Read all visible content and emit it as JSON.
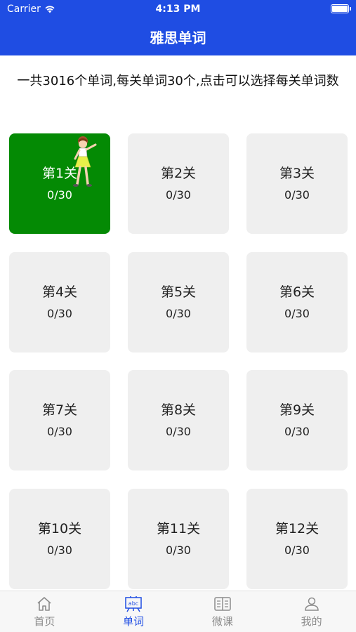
{
  "status": {
    "carrier": "Carrier",
    "time": "4:13 PM"
  },
  "header": {
    "title": "雅思单词"
  },
  "description": "一共3016个单词,每关单词30个,点击可以选择每关单词数",
  "levels": [
    {
      "label": "第1关",
      "progress": "0/30"
    },
    {
      "label": "第2关",
      "progress": "0/30"
    },
    {
      "label": "第3关",
      "progress": "0/30"
    },
    {
      "label": "第4关",
      "progress": "0/30"
    },
    {
      "label": "第5关",
      "progress": "0/30"
    },
    {
      "label": "第6关",
      "progress": "0/30"
    },
    {
      "label": "第7关",
      "progress": "0/30"
    },
    {
      "label": "第8关",
      "progress": "0/30"
    },
    {
      "label": "第9关",
      "progress": "0/30"
    },
    {
      "label": "第10关",
      "progress": "0/30"
    },
    {
      "label": "第11关",
      "progress": "0/30"
    },
    {
      "label": "第12关",
      "progress": "0/30"
    }
  ],
  "tabs": [
    {
      "label": "首页",
      "icon": "home-icon"
    },
    {
      "label": "单词",
      "icon": "abc-board-icon"
    },
    {
      "label": "微课",
      "icon": "book-icon"
    },
    {
      "label": "我的",
      "icon": "person-icon"
    }
  ],
  "colors": {
    "primary": "#1f4de3",
    "active_card": "#048a04",
    "card": "#efefef"
  }
}
